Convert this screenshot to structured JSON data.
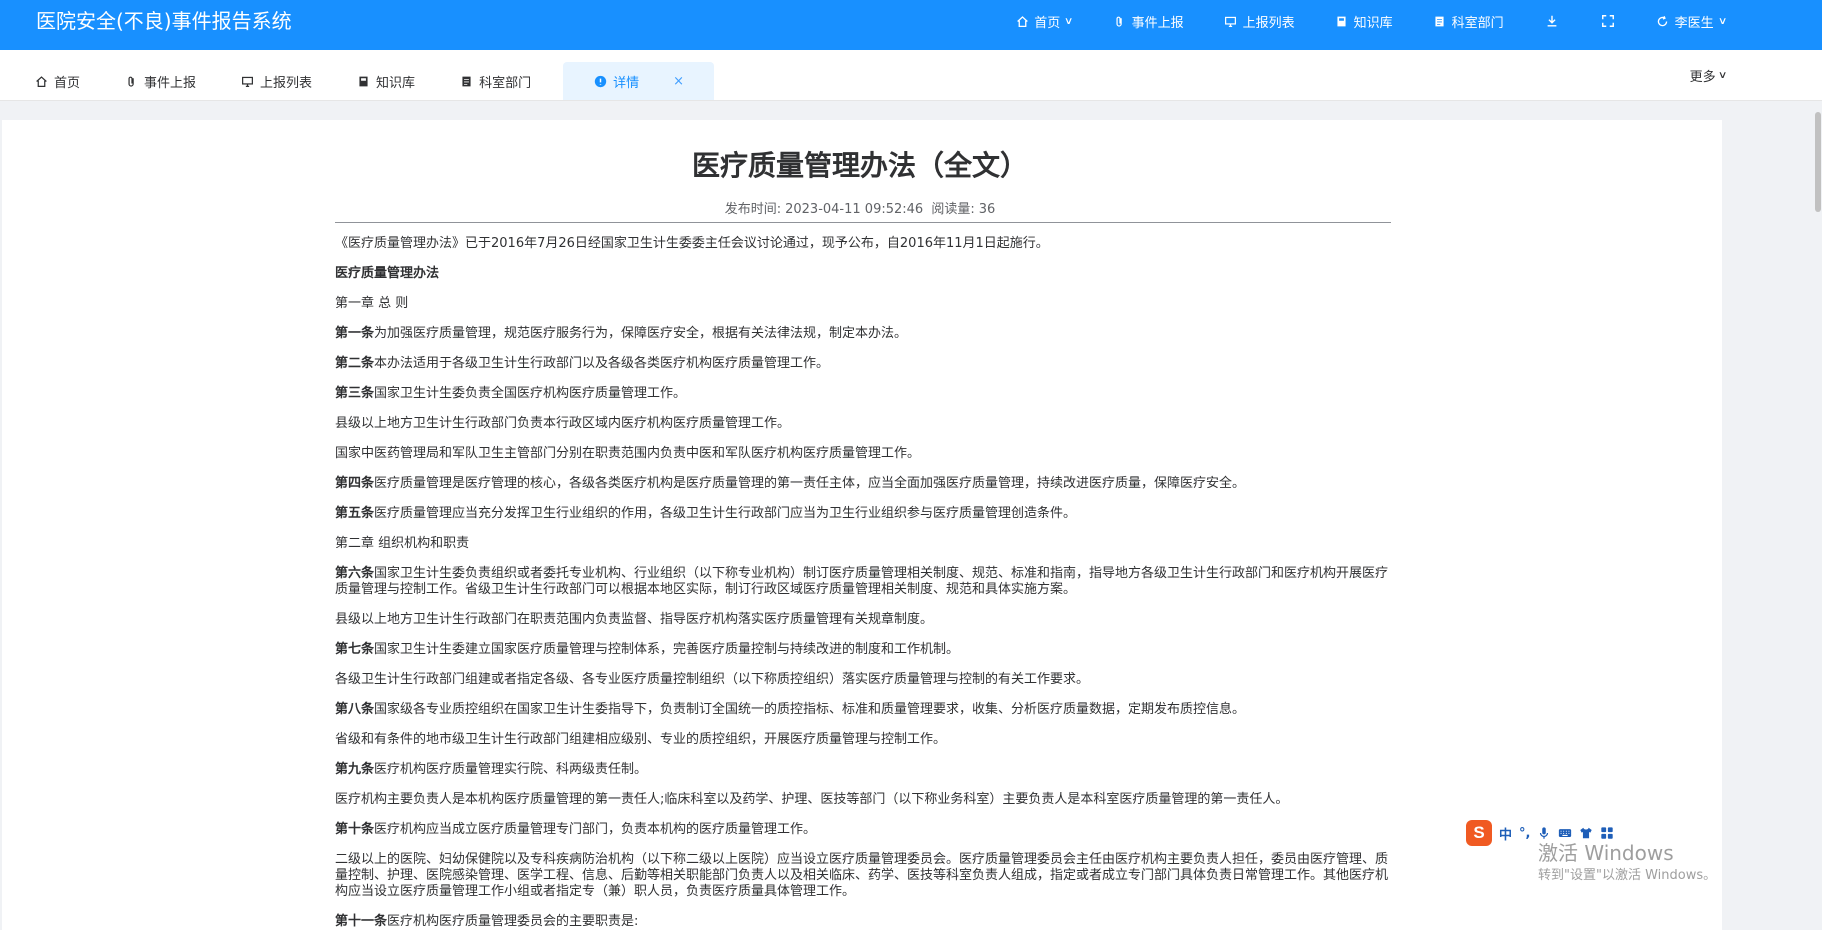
{
  "header": {
    "app_title": "医院安全(不良)事件报告系统",
    "nav": [
      {
        "label": "首页",
        "icon": "home-icon"
      },
      {
        "label": "事件上报",
        "icon": "paperclip-icon"
      },
      {
        "label": "上报列表",
        "icon": "monitor-icon"
      },
      {
        "label": "知识库",
        "icon": "book-icon"
      },
      {
        "label": "科室部门",
        "icon": "list-icon"
      }
    ],
    "user": "李医生"
  },
  "tabs": {
    "items": [
      {
        "label": "首页",
        "icon": "home-icon"
      },
      {
        "label": "事件上报",
        "icon": "paperclip-icon"
      },
      {
        "label": "上报列表",
        "icon": "monitor-icon"
      },
      {
        "label": "知识库",
        "icon": "book-icon"
      },
      {
        "label": "科室部门",
        "icon": "list-icon"
      }
    ],
    "active": {
      "label": "详情",
      "icon": "info-circle-icon",
      "close": "×"
    },
    "more": "更多"
  },
  "article": {
    "title": "医疗质量管理办法（全文）",
    "publish_label": "发布时间:",
    "publish_time": "2023-04-11 09:52:46",
    "views_label": "阅读量:",
    "views": "36",
    "paragraphs": [
      {
        "bold": "",
        "text": "《医疗质量管理办法》已于2016年7月26日经国家卫生计生委委主任会议讨论通过，现予公布，自2016年11月1日起施行。"
      },
      {
        "bold": "医疗质量管理办法",
        "text": ""
      },
      {
        "bold": "",
        "text": "第一章 总 则"
      },
      {
        "bold": "第一条",
        "text": "为加强医疗质量管理，规范医疗服务行为，保障医疗安全，根据有关法律法规，制定本办法。"
      },
      {
        "bold": "第二条",
        "text": "本办法适用于各级卫生计生行政部门以及各级各类医疗机构医疗质量管理工作。"
      },
      {
        "bold": "第三条",
        "text": "国家卫生计生委负责全国医疗机构医疗质量管理工作。"
      },
      {
        "bold": "",
        "text": "县级以上地方卫生计生行政部门负责本行政区域内医疗机构医疗质量管理工作。"
      },
      {
        "bold": "",
        "text": "国家中医药管理局和军队卫生主管部门分别在职责范围内负责中医和军队医疗机构医疗质量管理工作。"
      },
      {
        "bold": "第四条",
        "text": "医疗质量管理是医疗管理的核心，各级各类医疗机构是医疗质量管理的第一责任主体，应当全面加强医疗质量管理，持续改进医疗质量，保障医疗安全。"
      },
      {
        "bold": "第五条",
        "text": "医疗质量管理应当充分发挥卫生行业组织的作用，各级卫生计生行政部门应当为卫生行业组织参与医疗质量管理创造条件。"
      },
      {
        "bold": "",
        "text": "第二章 组织机构和职责"
      },
      {
        "bold": "第六条",
        "text": "国家卫生计生委负责组织或者委托专业机构、行业组织（以下称专业机构）制订医疗质量管理相关制度、规范、标准和指南，指导地方各级卫生计生行政部门和医疗机构开展医疗质量管理与控制工作。省级卫生计生行政部门可以根据本地区实际，制订行政区域医疗质量管理相关制度、规范和具体实施方案。"
      },
      {
        "bold": "",
        "text": "县级以上地方卫生计生行政部门在职责范围内负责监督、指导医疗机构落实医疗质量管理有关规章制度。"
      },
      {
        "bold": "第七条",
        "text": "国家卫生计生委建立国家医疗质量管理与控制体系，完善医疗质量控制与持续改进的制度和工作机制。"
      },
      {
        "bold": "",
        "text": "各级卫生计生行政部门组建或者指定各级、各专业医疗质量控制组织（以下称质控组织）落实医疗质量管理与控制的有关工作要求。"
      },
      {
        "bold": "第八条",
        "text": "国家级各专业质控组织在国家卫生计生委指导下，负责制订全国统一的质控指标、标准和质量管理要求，收集、分析医疗质量数据，定期发布质控信息。"
      },
      {
        "bold": "",
        "text": "省级和有条件的地市级卫生计生行政部门组建相应级别、专业的质控组织，开展医疗质量管理与控制工作。"
      },
      {
        "bold": "第九条",
        "text": "医疗机构医疗质量管理实行院、科两级责任制。"
      },
      {
        "bold": "",
        "text": "医疗机构主要负责人是本机构医疗质量管理的第一责任人;临床科室以及药学、护理、医技等部门（以下称业务科室）主要负责人是本科室医疗质量管理的第一责任人。"
      },
      {
        "bold": "第十条",
        "text": "医疗机构应当成立医疗质量管理专门部门，负责本机构的医疗质量管理工作。"
      },
      {
        "bold": "",
        "text": "二级以上的医院、妇幼保健院以及专科疾病防治机构（以下称二级以上医院）应当设立医疗质量管理委员会。医疗质量管理委员会主任由医疗机构主要负责人担任，委员由医疗管理、质量控制、护理、医院感染管理、医学工程、信息、后勤等相关职能部门负责人以及相关临床、药学、医技等科室负责人组成，指定或者成立专门部门具体负责日常管理工作。其他医疗机构应当设立医疗质量管理工作小组或者指定专（兼）职人员，负责医疗质量具体管理工作。"
      },
      {
        "bold": "第十一条",
        "text": "医疗机构医疗质量管理委员会的主要职责是:"
      }
    ]
  },
  "ime": {
    "logo": "S",
    "lang": "中",
    "punct": "°,"
  },
  "watermark": {
    "line1": "激活 Windows",
    "line2": "转到\"设置\"以激活 Windows。"
  }
}
